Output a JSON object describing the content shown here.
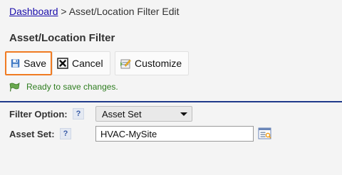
{
  "breadcrumb": {
    "dashboard_link": "Dashboard",
    "separator": ">",
    "current": "Asset/Location Filter Edit"
  },
  "page": {
    "title": "Asset/Location Filter"
  },
  "toolbar": {
    "save_label": "Save",
    "cancel_label": "Cancel",
    "customize_label": "Customize"
  },
  "status": {
    "message": "Ready to save changes."
  },
  "form": {
    "filter_option_label": "Filter Option:",
    "filter_option_value": "Asset Set",
    "asset_set_label": "Asset Set:",
    "asset_set_value": "HVAC-MySite",
    "help_glyph": "?"
  },
  "colors": {
    "link": "#1a0dab",
    "save_highlight": "#f07b22",
    "status_text": "#2e7d1f",
    "divider": "#1f3a8a"
  },
  "icons": {
    "save": "floppy-disk-icon",
    "cancel": "x-box-icon",
    "customize": "customize-icon",
    "status": "green-flag-icon",
    "lookup": "lookup-list-icon"
  }
}
